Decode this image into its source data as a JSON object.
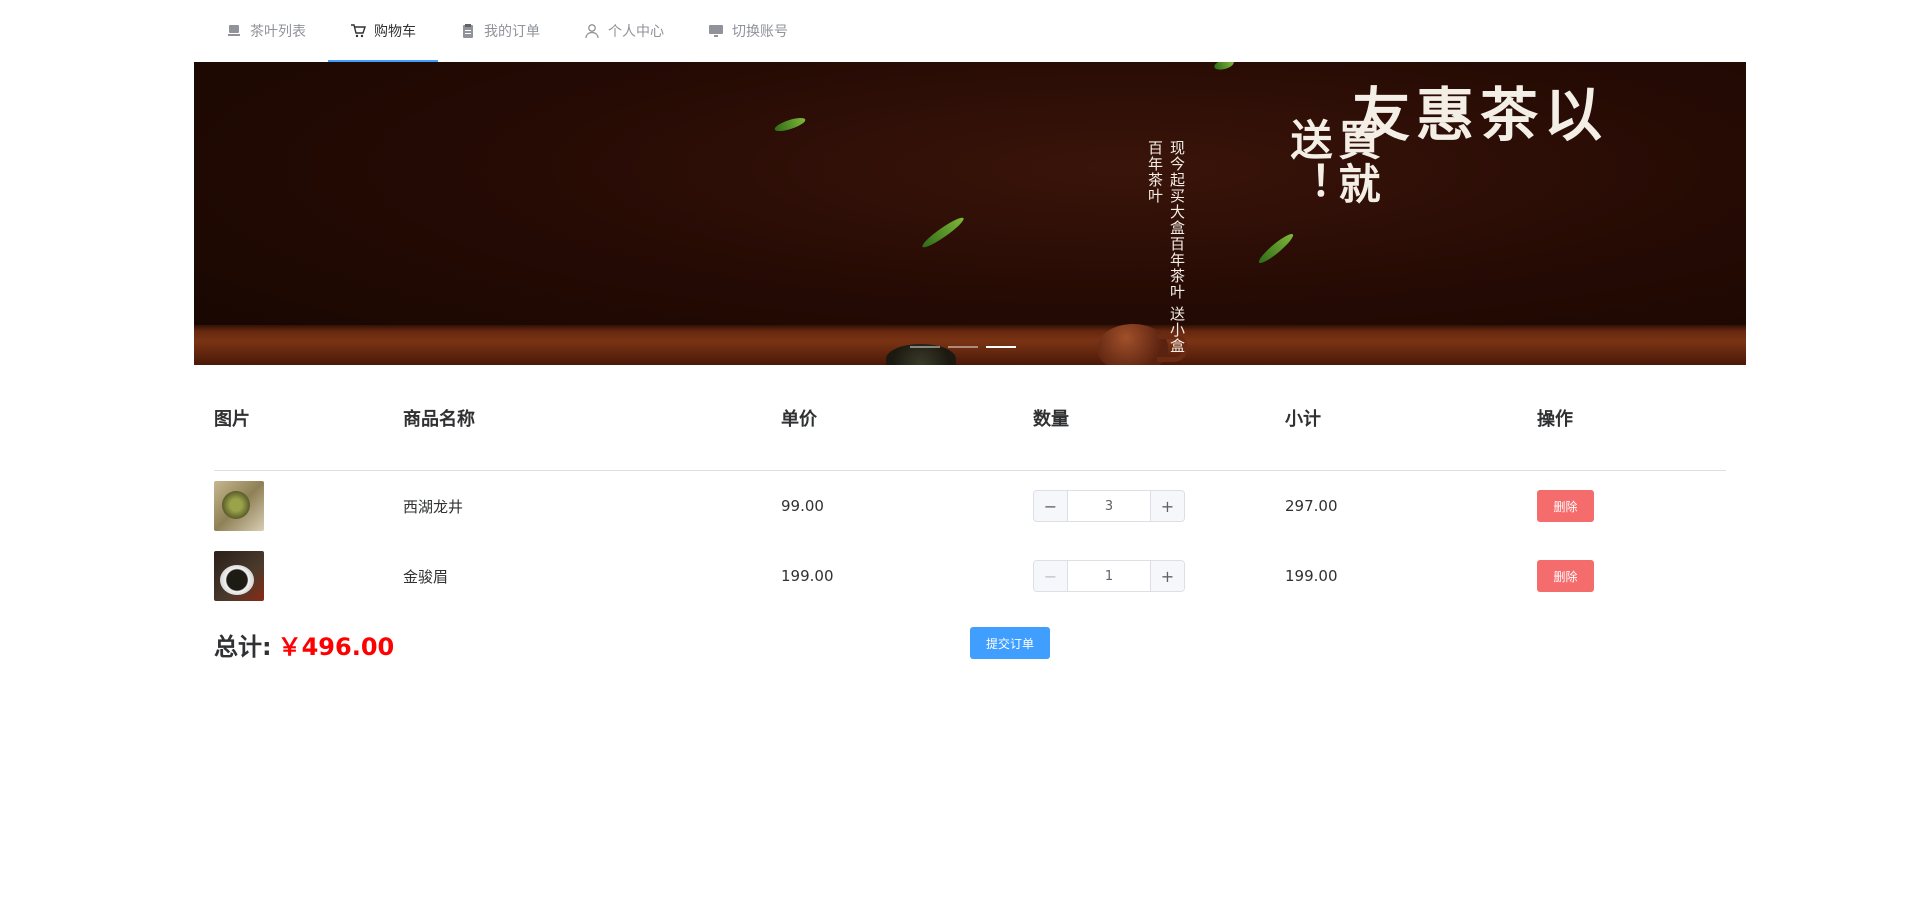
{
  "nav": {
    "items": [
      {
        "label": "茶叶列表",
        "icon": "tea-list-icon",
        "active": false
      },
      {
        "label": "购物车",
        "icon": "cart-icon",
        "active": true
      },
      {
        "label": "我的订单",
        "icon": "orders-icon",
        "active": false
      },
      {
        "label": "个人中心",
        "icon": "user-icon",
        "active": false
      },
      {
        "label": "切换账号",
        "icon": "monitor-icon",
        "active": false
      }
    ]
  },
  "banner": {
    "slogan_line1": "以茶惠友",
    "slogan_line2": "買就送！",
    "promo_line1": "现今起买大盒百年茶叶",
    "promo_line2": "送小盒百年茶叶",
    "slide_count": 3,
    "active_slide": 3
  },
  "cart": {
    "headers": {
      "image": "图片",
      "name": "商品名称",
      "price": "单价",
      "quantity": "数量",
      "subtotal": "小计",
      "action": "操作"
    },
    "rows": [
      {
        "name": "西湖龙井",
        "price": "99.00",
        "quantity": "3",
        "subtotal": "297.00",
        "delete_label": "删除"
      },
      {
        "name": "金骏眉",
        "price": "199.00",
        "quantity": "1",
        "subtotal": "199.00",
        "delete_label": "删除"
      }
    ],
    "total_label": "总计:",
    "total_amount": "￥496.00",
    "submit_label": "提交订单"
  },
  "colors": {
    "accent": "#409eff",
    "danger": "#f56c6c",
    "total": "#ff0000"
  }
}
